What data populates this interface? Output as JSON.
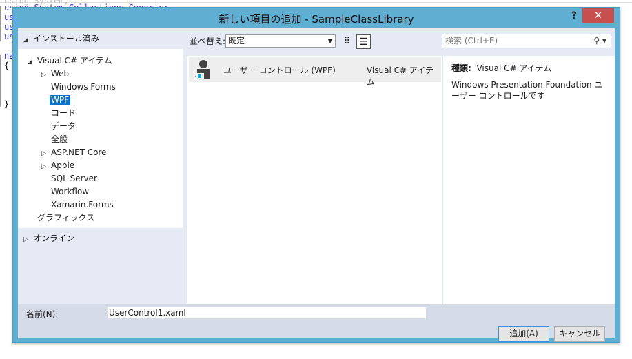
{
  "background_code": {
    "lines": [
      "using System;",
      "using System.Collections.Generic;",
      "us",
      "us",
      "us",
      "na",
      "{",
      "}"
    ]
  },
  "dialog": {
    "title": "新しい項目の追加 - SampleClassLibrary",
    "help_label": "?",
    "close_label": "✕",
    "left": {
      "installed": "インストール済み",
      "tree": [
        {
          "label": "Visual C# アイテム",
          "expanded": true
        },
        {
          "label": "Web",
          "collapsed": true
        },
        {
          "label": "Windows Forms"
        },
        {
          "label": "WPF",
          "selected": true
        },
        {
          "label": "コード"
        },
        {
          "label": "データ"
        },
        {
          "label": "全般"
        },
        {
          "label": "ASP.NET Core",
          "collapsed": true
        },
        {
          "label": "Apple",
          "collapsed": true
        },
        {
          "label": "SQL Server"
        },
        {
          "label": "Workflow"
        },
        {
          "label": "Xamarin.Forms"
        },
        {
          "label": "グラフィックス"
        }
      ],
      "online": "オンライン"
    },
    "toolbar": {
      "sort_label": "並べ替え:",
      "sort_value": "既定",
      "view_icons": [
        "grid-view-icon",
        "list-view-icon"
      ],
      "active_view": "list"
    },
    "search": {
      "placeholder": "検索 (Ctrl+E)"
    },
    "templates": [
      {
        "name": "ユーザー コントロール (WPF)",
        "type": "Visual C# アイテム",
        "icon": "user-control-icon",
        "selected": true
      }
    ],
    "info": {
      "type_label": "種類:",
      "type_value": "Visual C# アイテム",
      "description": "Windows Presentation Foundation ユーザー コントロールです"
    },
    "name_label": "名前(N):",
    "name_value": "UserControl1.xaml",
    "add_button": "追加(A)",
    "cancel_button": "キャンセル",
    "colors": {
      "titlebar": "#5eafd2",
      "close": "#c7504f",
      "selection": "#0a72c8"
    }
  }
}
